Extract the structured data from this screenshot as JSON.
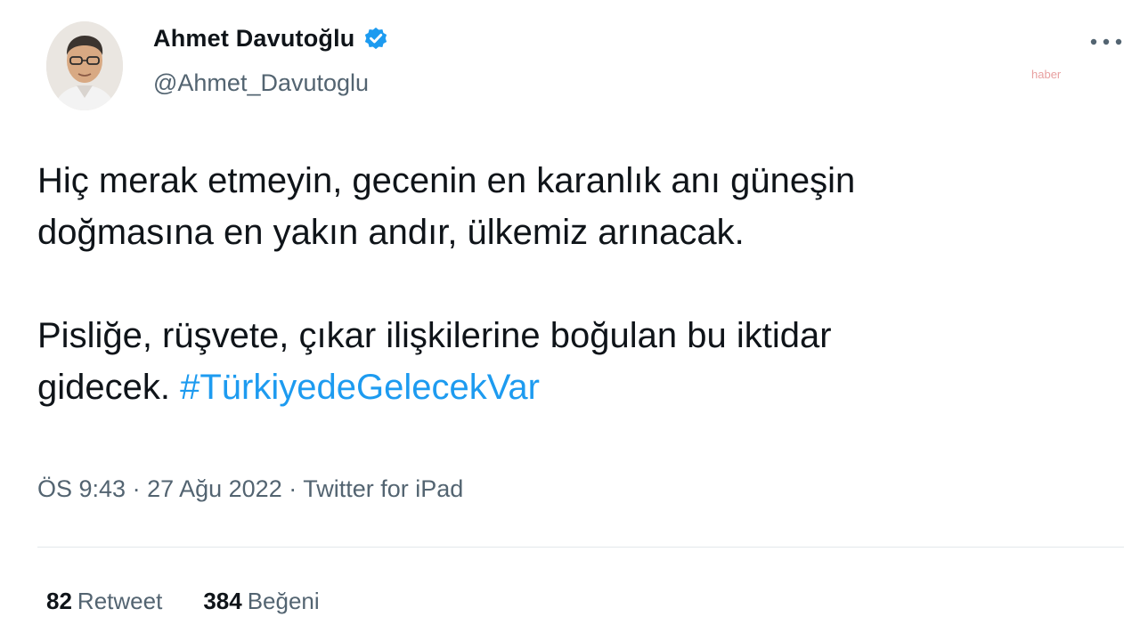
{
  "author": {
    "display_name": "Ahmet Davutoğlu",
    "handle": "@Ahmet_Davutoglu",
    "verified": true
  },
  "watermark": "haber",
  "tweet": {
    "line1": "Hiç merak etmeyin, gecenin en karanlık anı güneşin",
    "line2": "doğmasına en yakın andır, ülkemiz arınacak.",
    "line3": "Pisliğe, rüşvete, çıkar ilişkilerine boğulan bu iktidar",
    "line4_text": "gidecek. ",
    "hashtag": "#TürkiyedeGelecekVar"
  },
  "meta": {
    "time": "ÖS 9:43",
    "separator1": " · ",
    "date": "27 Ağu 2022",
    "separator2": " · ",
    "source": "Twitter for iPad"
  },
  "stats": {
    "retweet_count": "82",
    "retweet_label": "Retweet",
    "like_count": "384",
    "like_label": "Beğeni"
  },
  "colors": {
    "link": "#1d9bf0",
    "secondary_text": "#536471",
    "primary_text": "#0f1419"
  },
  "icons": {
    "verified": "verified-badge-icon",
    "more": "more-horizontal-icon"
  }
}
